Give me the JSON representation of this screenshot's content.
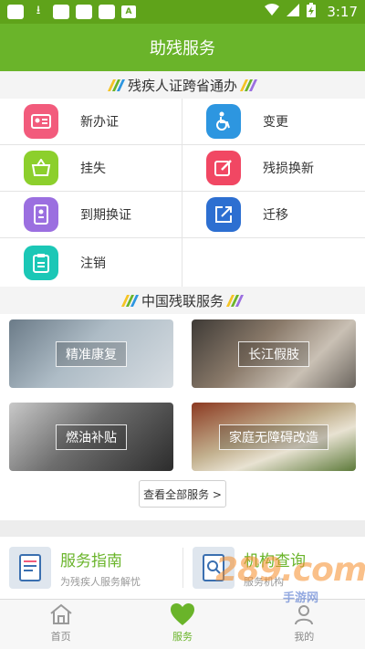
{
  "statusbar": {
    "time": "3:17",
    "a_box": "A"
  },
  "header": {
    "title": "助残服务"
  },
  "section1": {
    "title": "残疾人证跨省通办"
  },
  "grid": [
    {
      "label": "新办证",
      "icon": "id-card-icon",
      "color": "#f25b7c"
    },
    {
      "label": "变更",
      "icon": "wheelchair-icon",
      "color": "#2d96e0"
    },
    {
      "label": "挂失",
      "icon": "basket-icon",
      "color": "#8ccf2c"
    },
    {
      "label": "残损换新",
      "icon": "edit-icon",
      "color": "#f14763"
    },
    {
      "label": "到期换证",
      "icon": "book-icon",
      "color": "#9b6fe0"
    },
    {
      "label": "迁移",
      "icon": "share-icon",
      "color": "#2d6fd1"
    },
    {
      "label": "注销",
      "icon": "clipboard-icon",
      "color": "#1bc7b6"
    }
  ],
  "section2": {
    "title": "中国残联服务"
  },
  "cards": [
    {
      "label": "精准康复"
    },
    {
      "label": "长江假肢"
    },
    {
      "label": "燃油补贴"
    },
    {
      "label": "家庭无障碍改造"
    }
  ],
  "view_all": "查看全部服务 >",
  "guide": [
    {
      "title": "服务指南",
      "sub": "为残疾人服务解忧"
    },
    {
      "title": "机构查询",
      "sub": "服务机构"
    }
  ],
  "tabs": [
    {
      "label": "首页"
    },
    {
      "label": "服务"
    },
    {
      "label": "我的"
    }
  ],
  "watermark": {
    "brand": "289.com",
    "sub": "手游网"
  }
}
